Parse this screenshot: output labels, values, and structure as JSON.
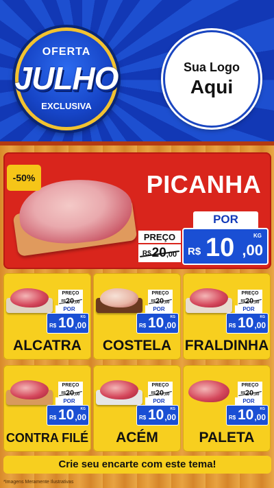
{
  "header": {
    "badge": {
      "top": "OFERTA",
      "main": "JULHO",
      "bottom": "EXCLUSIVA"
    },
    "logo": {
      "line1": "Sua Logo",
      "line2": "Aqui"
    }
  },
  "featured": {
    "discount": "-50%",
    "name": "PICANHA",
    "preco_label": "PREÇO",
    "old_currency": "R$",
    "old_int": "20",
    "old_dec": ",00",
    "por_label": "POR",
    "currency": "R$",
    "price_int": "10",
    "price_dec": ",00",
    "unit": "KG"
  },
  "products": [
    {
      "name": "ALCATRA",
      "preco_label": "PREÇO",
      "old_currency": "R$",
      "old_int": "20",
      "old_dec": ",00",
      "por_label": "POR",
      "currency": "R$",
      "price_int": "10",
      "price_dec": ",00",
      "unit": "KG"
    },
    {
      "name": "COSTELA",
      "preco_label": "PREÇO",
      "old_currency": "R$",
      "old_int": "20",
      "old_dec": ",00",
      "por_label": "POR",
      "currency": "R$",
      "price_int": "10",
      "price_dec": ",00",
      "unit": "KG"
    },
    {
      "name": "FRALDINHA",
      "preco_label": "PREÇO",
      "old_currency": "R$",
      "old_int": "20",
      "old_dec": ",00",
      "por_label": "POR",
      "currency": "R$",
      "price_int": "10",
      "price_dec": ",00",
      "unit": "KG"
    },
    {
      "name": "CONTRA FILÉ",
      "preco_label": "PREÇO",
      "old_currency": "R$",
      "old_int": "20",
      "old_dec": ",00",
      "por_label": "POR",
      "currency": "R$",
      "price_int": "10",
      "price_dec": ",00",
      "unit": "KG"
    },
    {
      "name": "ACÉM",
      "preco_label": "PREÇO",
      "old_currency": "R$",
      "old_int": "20",
      "old_dec": ",00",
      "por_label": "POR",
      "currency": "R$",
      "price_int": "10",
      "price_dec": ",00",
      "unit": "KG"
    },
    {
      "name": "PALETA",
      "preco_label": "PREÇO",
      "old_currency": "R$",
      "old_int": "20",
      "old_dec": ",00",
      "por_label": "POR",
      "currency": "R$",
      "price_int": "10",
      "price_dec": ",00",
      "unit": "KG"
    }
  ],
  "footer": {
    "cta": "Crie seu encarte com este tema!",
    "disclaimer": "*Imagens Meramente Ilustrativas"
  },
  "colors": {
    "header_blue": "#1d4fd0",
    "featured_red": "#d9251c",
    "card_yellow": "#f7cf1f",
    "price_blue": "#1a4fd4",
    "badge_gold": "#f2c230"
  }
}
